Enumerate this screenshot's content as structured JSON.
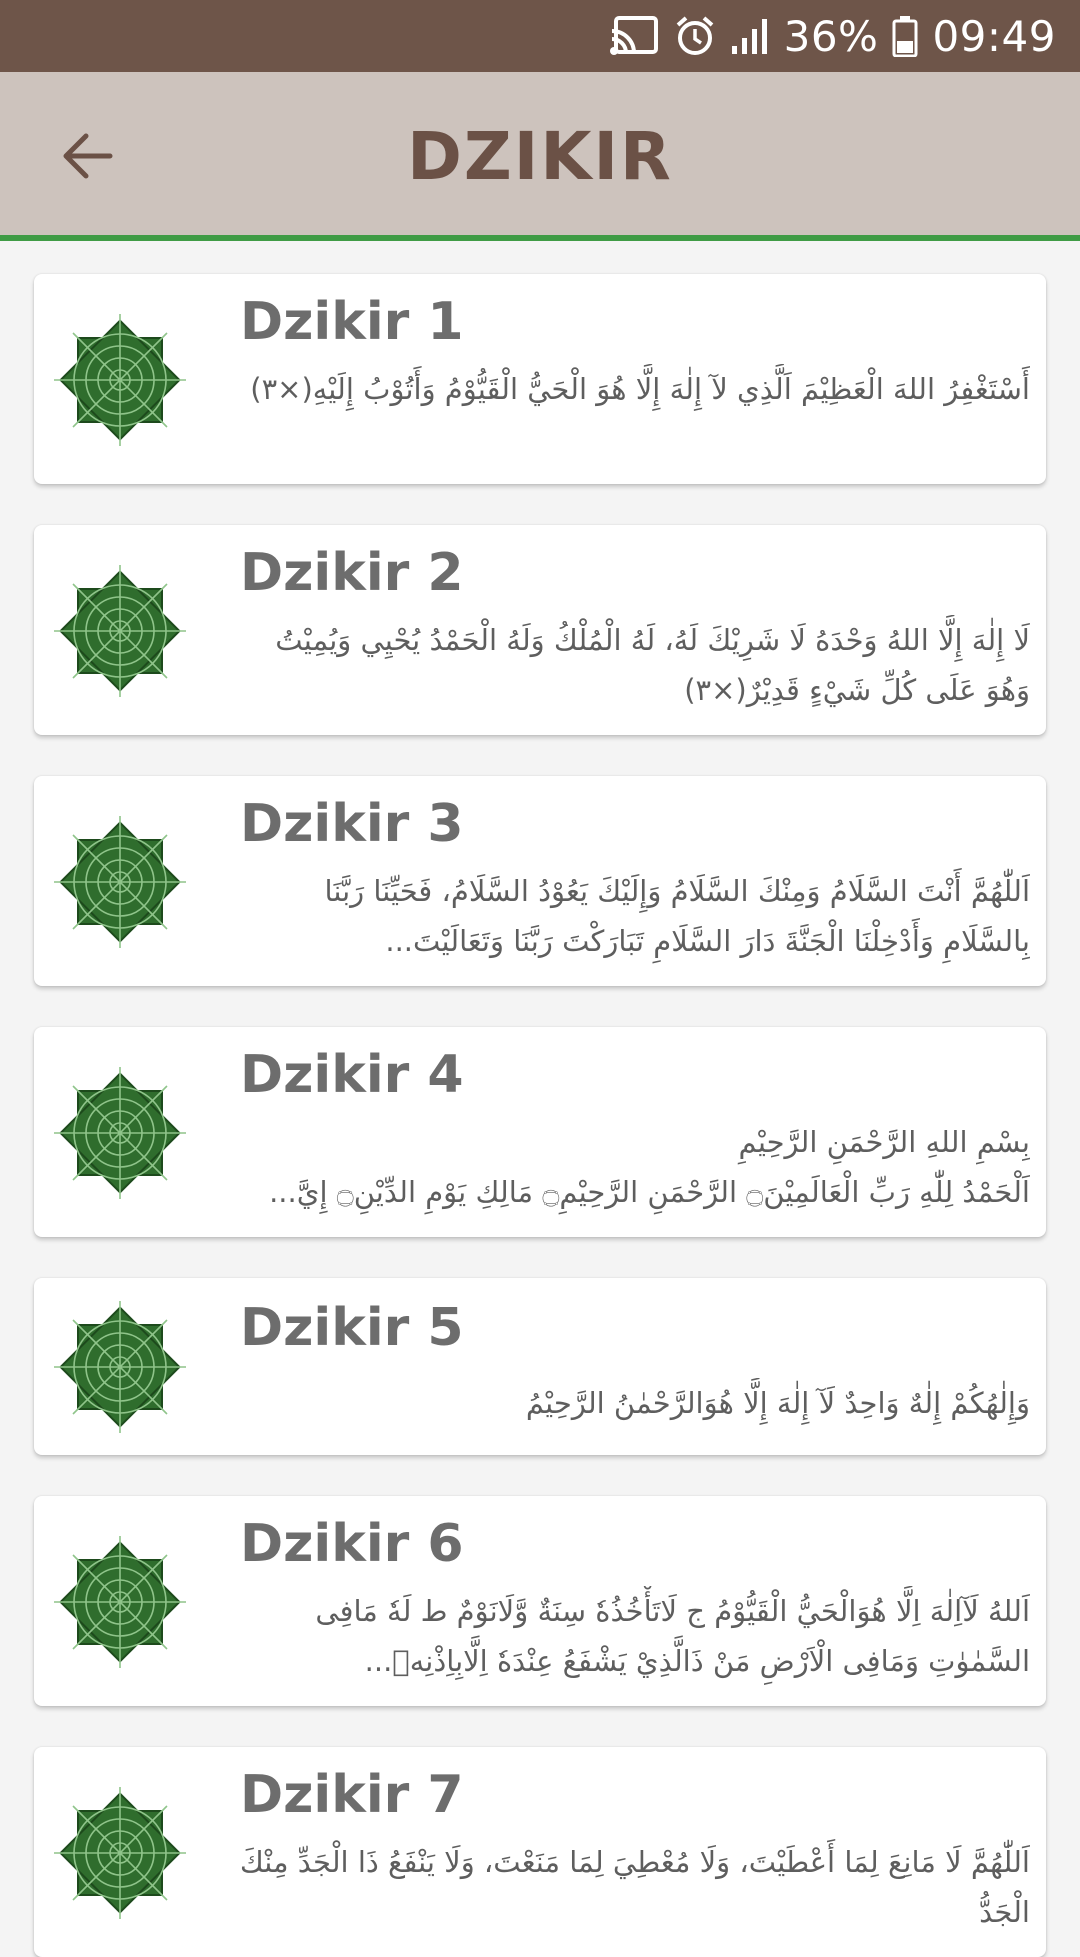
{
  "status_bar": {
    "battery": "36%",
    "time": "09:49",
    "icons": [
      "cast-icon",
      "alarm-icon",
      "signal-icon",
      "battery-icon"
    ]
  },
  "app_bar": {
    "title": "DZIKIR",
    "back_icon": "arrow-left-icon"
  },
  "colors": {
    "status_bar": "#6e5549",
    "app_bar": "#cdc3bd",
    "accent_line": "#3f9b45",
    "title": "#6b5146",
    "ornament": "#2e6b2c"
  },
  "items": [
    {
      "title": "Dzikir 1",
      "text": "أَسْتَغْفِرُ اللهَ الْعَظِيْمَ اَلَّذِي لآ إِلٰهَ إِلَّا هُوَ الْحَيُّ الْقَيُّوْمُ وَأَتُوْبُ إِلَيْهِ(×٣)"
    },
    {
      "title": "Dzikir 2",
      "text": "لَا إِلٰهَ إِلَّا اللهُ وَحْدَهُ لَا شَرِيْكَ لَهُ، لَهُ الْمُلْكُ وَلَهُ الْحَمْدُ يُحْيِي وَيُمِيْتُ وَهُوَ عَلَى كُلِّ شَيْءٍ قَدِيْرٌ(×٣)"
    },
    {
      "title": "Dzikir 3",
      "text": "اَللّٰهُمَّ أَنْتَ السَّلَامُ وَمِنْكَ السَّلَامُ وَإِلَيْكَ يَعُوْدُ السَّلَامُ، فَحَيِّنَا رَبَّنَا بِالسَّلَامِ وَأَدْخِلْنَا الْجَنَّةَ دَارَ السَّلَامِ تَبَارَكْتَ رَبَّنَا وَتَعَالَيْتَ..."
    },
    {
      "title": "Dzikir 4",
      "text": "بِسْمِ اللهِ الرَّحْمَنِ الرَّحِيْمِ\nاَلْحَمْدُ لِلّٰهِ رَبِّ الْعَالَمِيْنَ۝ الرَّحْمَنِ الرَّحِيْمِ۝ مَالِكِ يَوْمِ الدِّيْنِ۝ إِيَّ..."
    },
    {
      "title": "Dzikir 5",
      "text": "وَإِلٰهُكُمْ إِلٰهٌ وَاحِدٌ لَآ إِلٰهَ إِلَّا هُوَالرَّحْمٰنُ الرَّحِيْمُ"
    },
    {
      "title": "Dzikir 6",
      "text": "اَللهُ لَآاِلٰهَ اِلَّا هُوَالْحَيُّ الْقَيُّوْمُ ج لَاتَأْخُذُهٗ سِنَةٌ وَّلَانَوْمٌ ط لَهٗ مَافِى السَّمٰوٰتِ وَمَافِى الْاَرْضِ مَنْ ذَالَّذِيْ يَشْفَعُ عِنْدَهٗ اِلَّابِاِذْنِهٖ..."
    },
    {
      "title": "Dzikir 7",
      "text": "اَللّٰهُمَّ لَا مَانِعَ لِمَا أَعْطَيْتَ، وَلَا مُعْطِيَ لِمَا مَنَعْتَ، وَلَا يَنْفَعُ ذَا الْجَدِّ مِنْكَ الْجَدُّ"
    }
  ]
}
